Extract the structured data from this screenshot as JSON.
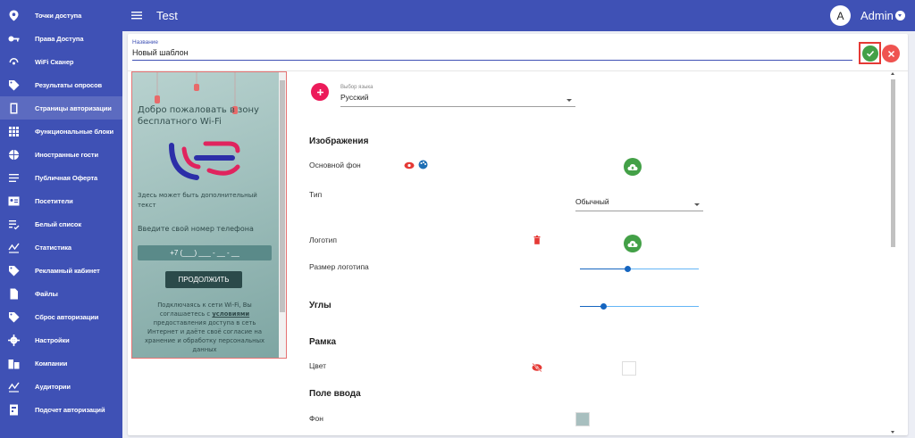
{
  "sidebar": {
    "items": [
      {
        "label": "Точки доступа",
        "icon": "location-pin-icon"
      },
      {
        "label": "Права Доступа",
        "icon": "key-icon"
      },
      {
        "label": "WiFi Сканер",
        "icon": "wifi-scan-icon"
      },
      {
        "label": "Результаты опросов",
        "icon": "tag-icon"
      },
      {
        "label": "Страницы авторизации",
        "icon": "tablet-icon",
        "active": true
      },
      {
        "label": "Функциональные блоки",
        "icon": "grid-icon"
      },
      {
        "label": "Иностранные гости",
        "icon": "globe-icon"
      },
      {
        "label": "Публичная Оферта",
        "icon": "lines-icon"
      },
      {
        "label": "Посетители",
        "icon": "id-card-icon"
      },
      {
        "label": "Белый список",
        "icon": "list-check-icon"
      },
      {
        "label": "Статистика",
        "icon": "chart-zigzag-icon"
      },
      {
        "label": "Рекламный кабинет",
        "icon": "tag-icon"
      },
      {
        "label": "Файлы",
        "icon": "file-icon"
      },
      {
        "label": "Сброс авторизации",
        "icon": "tag-icon"
      },
      {
        "label": "Настройки",
        "icon": "gear-icon"
      },
      {
        "label": "Компании",
        "icon": "building-icon"
      },
      {
        "label": "Аудитории",
        "icon": "chart-zigzag-icon"
      },
      {
        "label": "Подсчет авторизаций",
        "icon": "counter-icon"
      }
    ]
  },
  "topbar": {
    "title": "Test",
    "avatar_letter": "A",
    "user_name": "Admin"
  },
  "form": {
    "name_label": "Название",
    "name_value": "Новый шаблон"
  },
  "preview": {
    "title": "Добро пожаловать в зону бесплатного Wi-Fi",
    "subtitle": "Здесь может быть дополнительный текст",
    "phone_label": "Введите свой номер телефона",
    "phone_mask": "+7 (___) ___ - __ - __",
    "button": "ПРОДОЛЖИТЬ",
    "consent_before": "Подключаясь к сети Wi-Fi, Вы соглашаетесь с ",
    "consent_link": "условиями",
    "consent_after": " предоставления доступа в сеть Интернет и даёте своё согласие на хранение и обработку персональных данных"
  },
  "settings": {
    "language_label": "Выбор языка",
    "language_value": "Русский",
    "images_heading": "Изображения",
    "main_bg_label": "Основной фон",
    "type_label": "Тип",
    "type_value": "Обычный",
    "logo_label": "Логотип",
    "logo_size_label": "Размер логотипа",
    "logo_size_level": 0.4,
    "corners_heading": "Углы",
    "corners_level": 0.2,
    "frame_heading": "Рамка",
    "color_label": "Цвет",
    "input_heading": "Поле ввода",
    "bg_label": "Фон",
    "input_bg_color": "#a8bfbf"
  },
  "colors": {
    "primary": "#3f51b5",
    "confirm": "#43a047",
    "cancel": "#ef5350",
    "accent": "#ec1b5a"
  }
}
